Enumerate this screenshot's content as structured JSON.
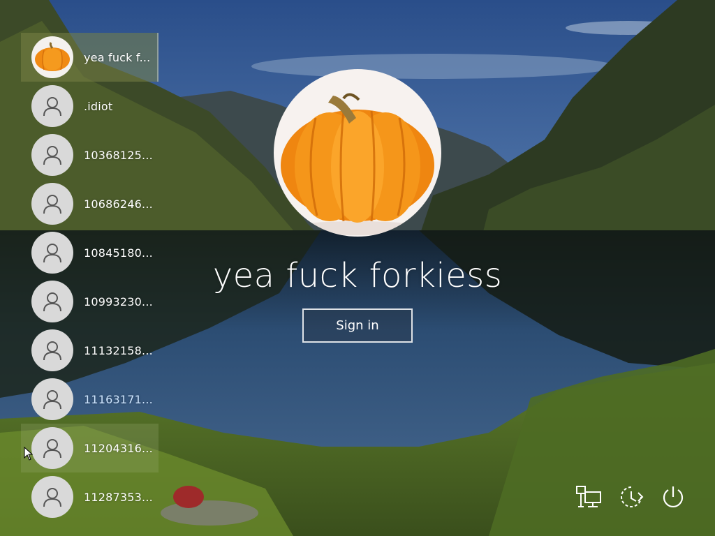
{
  "users": [
    {
      "name": "yea fuck f...",
      "avatar": "pumpkin-icon",
      "selected": true
    },
    {
      "name": ".idiot",
      "avatar": "user-icon"
    },
    {
      "name": "10368125...",
      "avatar": "user-icon"
    },
    {
      "name": "10686246...",
      "avatar": "user-icon"
    },
    {
      "name": "10845180...",
      "avatar": "user-icon"
    },
    {
      "name": "10993230...",
      "avatar": "user-icon"
    },
    {
      "name": "11132158...",
      "avatar": "user-icon"
    },
    {
      "name": "11163171...",
      "avatar": "user-icon"
    },
    {
      "name": "11204316...",
      "avatar": "user-icon",
      "hover": true
    },
    {
      "name": "11287353...",
      "avatar": "user-icon"
    }
  ],
  "main": {
    "display_name": "yea fuck forkiess",
    "signin_label": "Sign in"
  },
  "system_icons": [
    "network-icon",
    "ease-of-access-icon",
    "power-icon"
  ],
  "colors": {
    "accent_text": "#cfe6ff",
    "selected_bg": "#787846",
    "avatar_bg": "#d9d9d9"
  }
}
